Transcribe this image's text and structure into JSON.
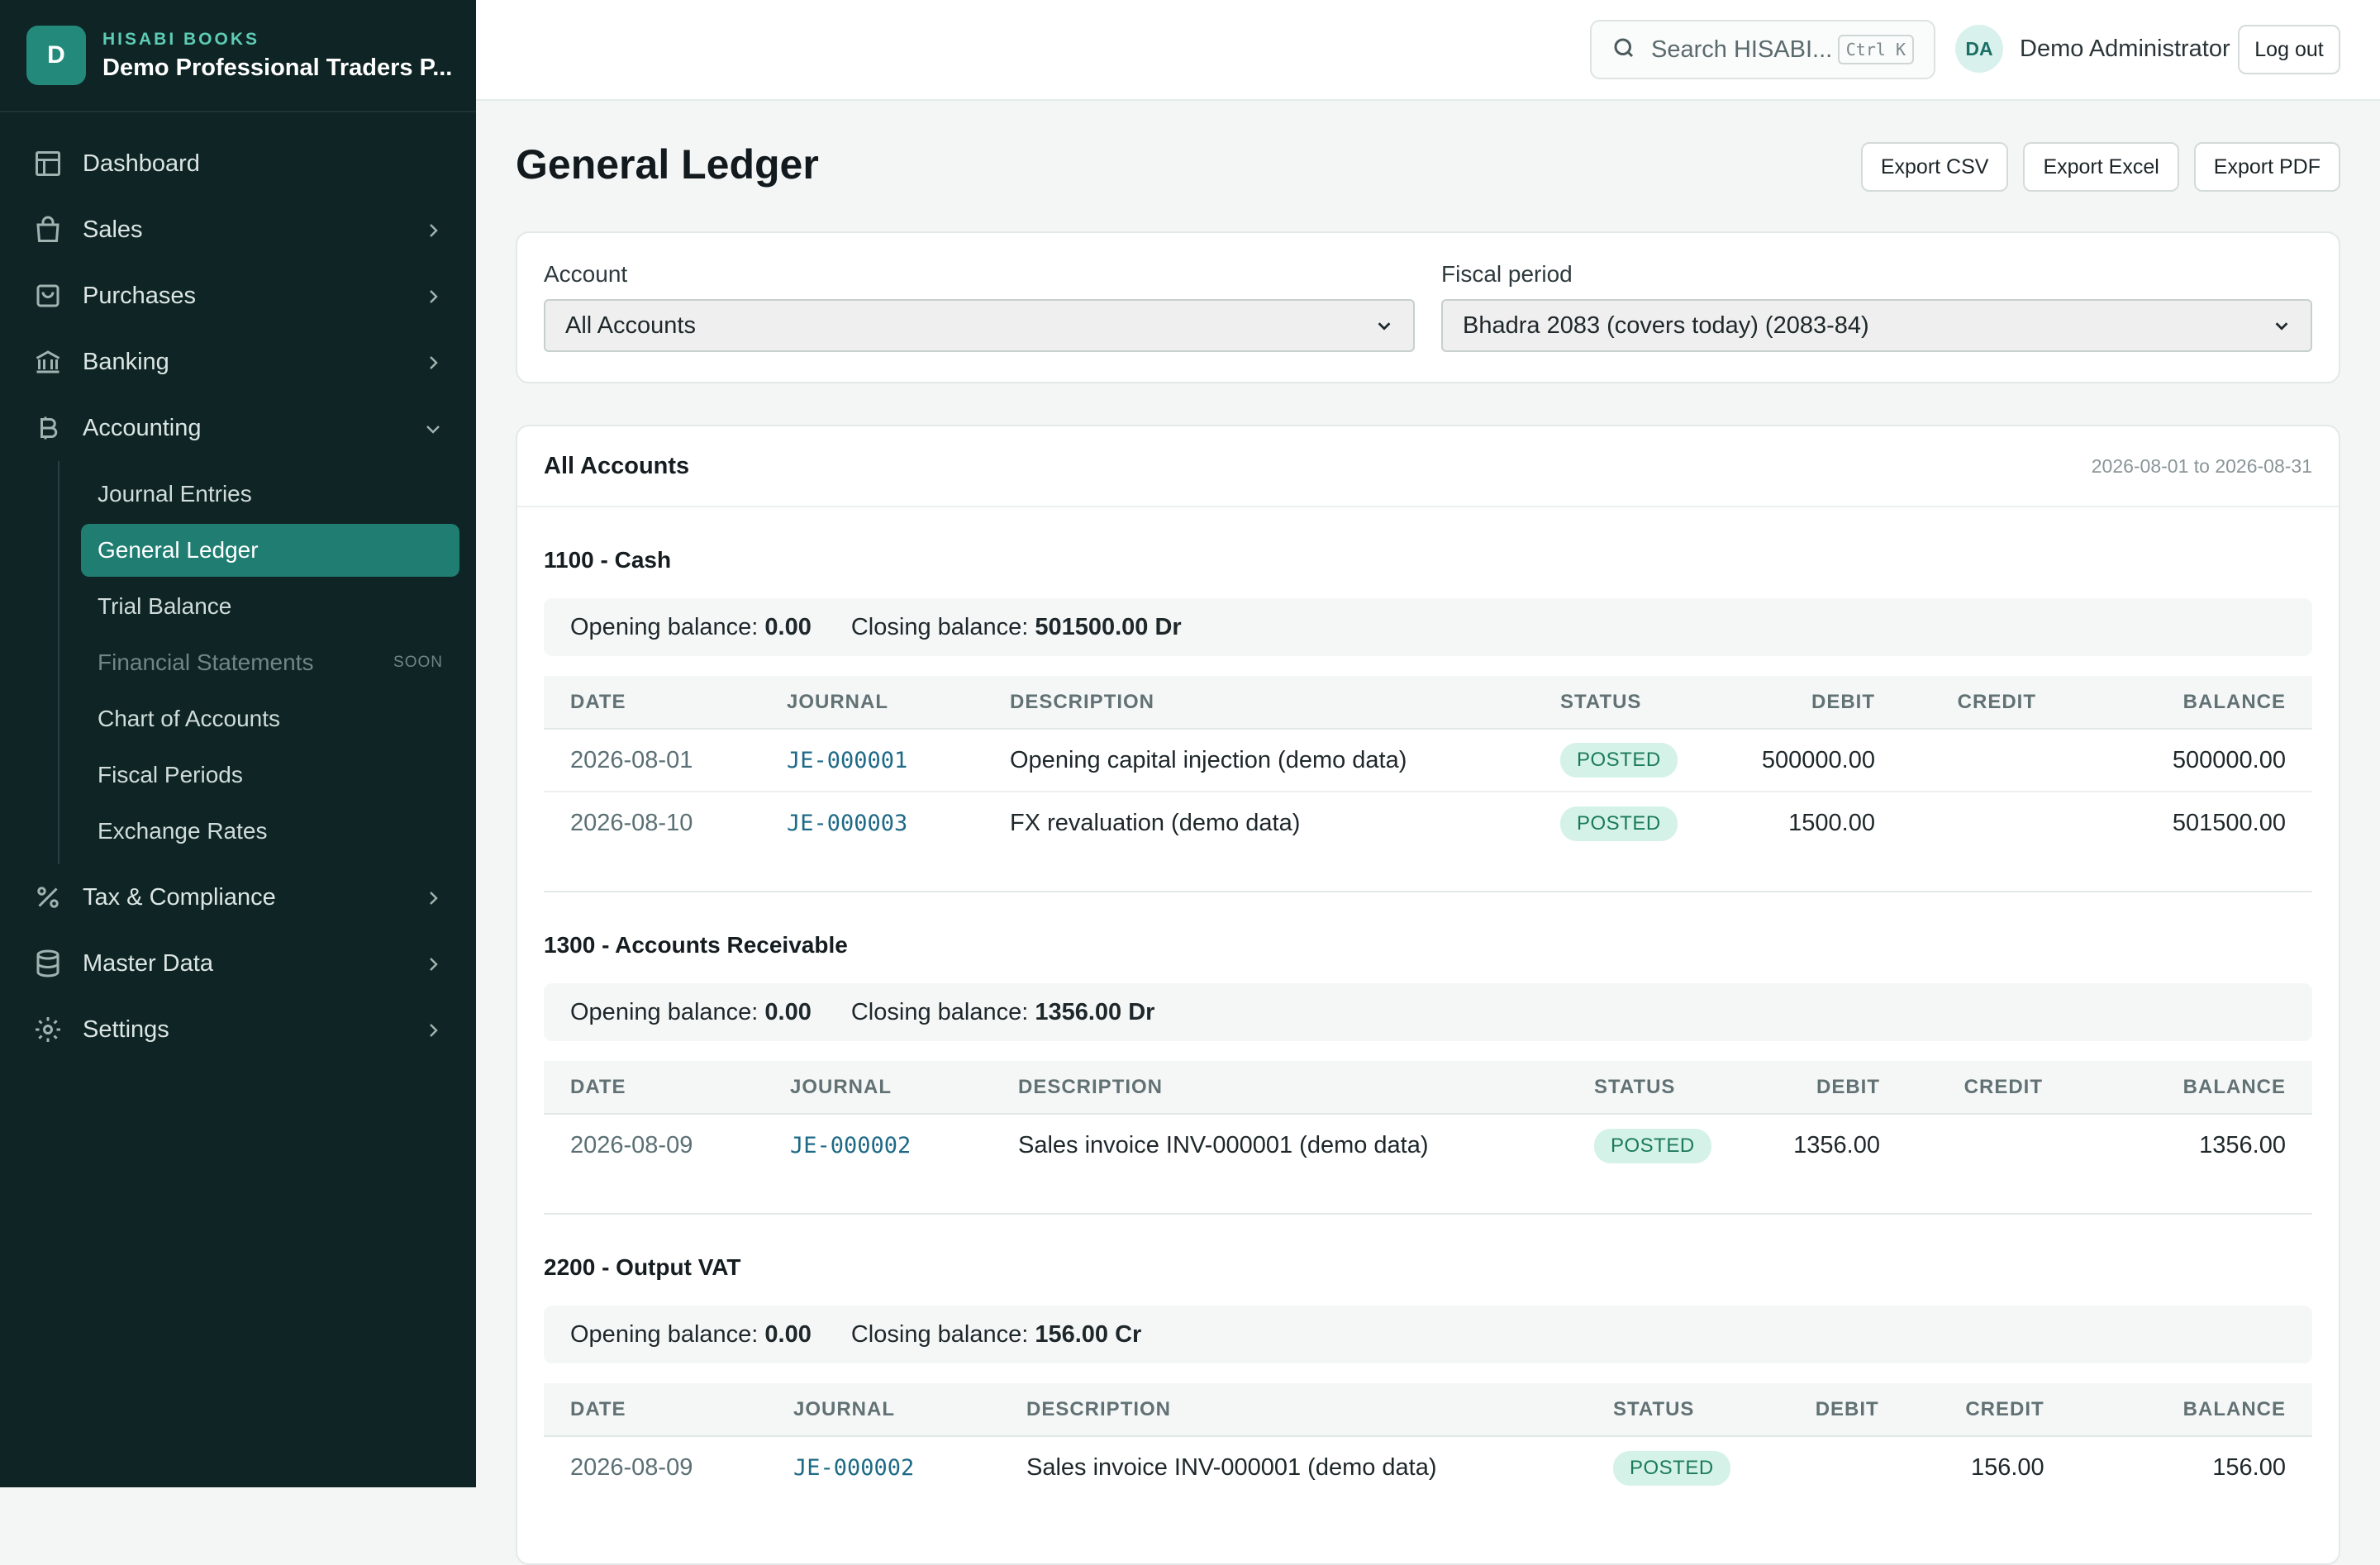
{
  "brand": {
    "logo_letter": "D",
    "kicker": "HISABI BOOKS",
    "company": "Demo Professional Traders P..."
  },
  "sidebar": {
    "items": [
      {
        "label": "Dashboard"
      },
      {
        "label": "Sales"
      },
      {
        "label": "Purchases"
      },
      {
        "label": "Banking"
      },
      {
        "label": "Accounting"
      },
      {
        "label": "Tax & Compliance"
      },
      {
        "label": "Master Data"
      },
      {
        "label": "Settings"
      }
    ],
    "accounting_sub": [
      {
        "label": "Journal Entries"
      },
      {
        "label": "General Ledger"
      },
      {
        "label": "Trial Balance"
      },
      {
        "label": "Financial Statements",
        "tag": "SOON"
      },
      {
        "label": "Chart of Accounts"
      },
      {
        "label": "Fiscal Periods"
      },
      {
        "label": "Exchange Rates"
      }
    ]
  },
  "topbar": {
    "search_placeholder": "Search HISABI...",
    "shortcut": "Ctrl K",
    "user_initials": "DA",
    "user_name": "Demo Administrator",
    "logout_label": "Log out"
  },
  "page": {
    "title": "General Ledger",
    "export_csv": "Export CSV",
    "export_excel": "Export Excel",
    "export_pdf": "Export PDF"
  },
  "filters": {
    "account_label": "Account",
    "account_value": "All Accounts",
    "period_label": "Fiscal period",
    "period_value": "Bhadra 2083 (covers today) (2083-84)"
  },
  "ledger": {
    "title": "All Accounts",
    "range": "2026-08-01 to 2026-08-31",
    "columns": [
      "DATE",
      "JOURNAL",
      "DESCRIPTION",
      "STATUS",
      "DEBIT",
      "CREDIT",
      "BALANCE"
    ],
    "opening_label": "Opening balance:",
    "closing_label": "Closing balance:",
    "accounts": [
      {
        "name": "1100 - Cash",
        "opening": "0.00",
        "closing": "501500.00 Dr",
        "rows": [
          {
            "date": "2026-08-01",
            "journal": "JE-000001",
            "description": "Opening capital injection (demo data)",
            "status": "POSTED",
            "debit": "500000.00",
            "credit": "",
            "balance": "500000.00"
          },
          {
            "date": "2026-08-10",
            "journal": "JE-000003",
            "description": "FX revaluation (demo data)",
            "status": "POSTED",
            "debit": "1500.00",
            "credit": "",
            "balance": "501500.00"
          }
        ]
      },
      {
        "name": "1300 - Accounts Receivable",
        "opening": "0.00",
        "closing": "1356.00 Dr",
        "rows": [
          {
            "date": "2026-08-09",
            "journal": "JE-000002",
            "description": "Sales invoice INV-000001 (demo data)",
            "status": "POSTED",
            "debit": "1356.00",
            "credit": "",
            "balance": "1356.00"
          }
        ]
      },
      {
        "name": "2200 - Output VAT",
        "opening": "0.00",
        "closing": "156.00 Cr",
        "rows": [
          {
            "date": "2026-08-09",
            "journal": "JE-000002",
            "description": "Sales invoice INV-000001 (demo data)",
            "status": "POSTED",
            "debit": "",
            "credit": "156.00",
            "balance": "156.00"
          }
        ]
      }
    ]
  },
  "colors": {
    "sidebar_bg": "#0f2424",
    "accent": "#1f7d71",
    "posted_badge": "#d5f2e8"
  }
}
